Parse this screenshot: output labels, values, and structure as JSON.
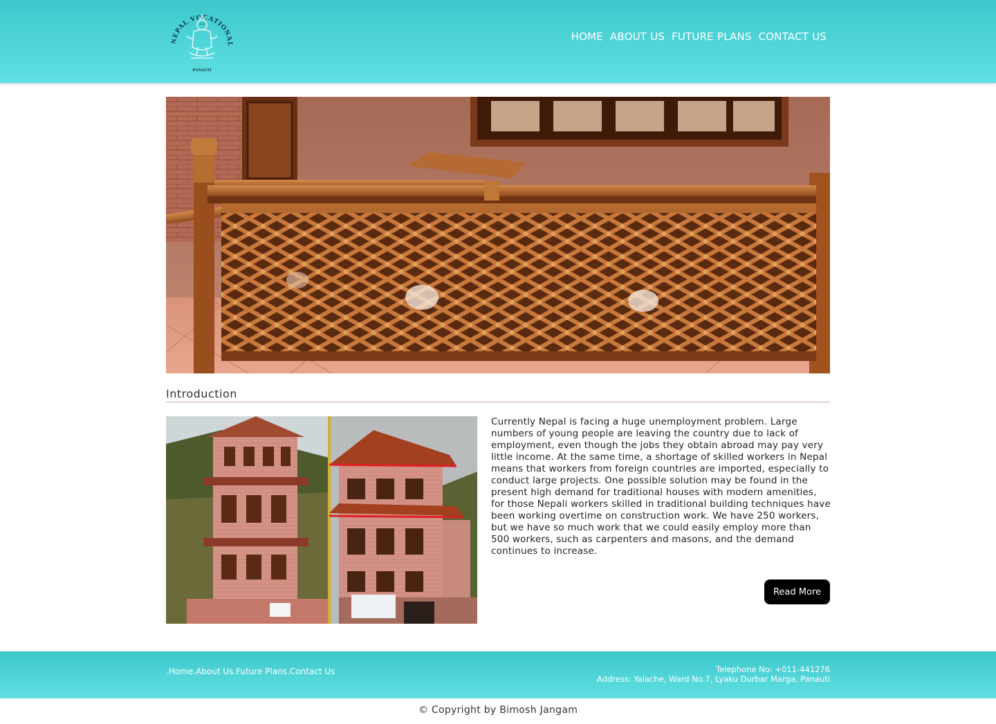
{
  "header": {
    "logo": {
      "text_top": "NEPAL VOCATIONAL ACADEMY",
      "text_bottom": "PANAUTI",
      "icon": "deity-emblem-logo"
    },
    "nav": [
      {
        "label": "HOME"
      },
      {
        "label": "ABOUT US"
      },
      {
        "label": "FUTURE PLANS"
      },
      {
        "label": "CONTACT US"
      }
    ]
  },
  "hero": {
    "alt": "carved wooden lattice railing"
  },
  "intro": {
    "title": "Introduction",
    "body": "Currently Nepal is facing a huge unemployment problem. Large numbers of young people are leaving the country due to lack of employment, even though the jobs they obtain abroad may pay very little income. At the same time, a shortage of skilled workers in Nepal means that workers from foreign countries are imported, especially to conduct large projects. One possible solution may be found in the present high demand for traditional houses with modern amenities, for those Nepali workers skilled in traditional building techniques have been working overtime on construction work. We have 250 workers, but we have so much work that we could easily employ more than 500 workers, such as carpenters and masons, and the demand continues to increase.",
    "read_more": "Read More"
  },
  "footer": {
    "links": [
      {
        "label": ".Home"
      },
      {
        "label": ".About Us"
      },
      {
        "label": ".Future Plans"
      },
      {
        "label": ".Contact Us"
      }
    ],
    "telephone": "Telephone No: +011-441276",
    "address": "Address: Yalache, Ward No.7, Lyaku Durbar Marga, Panauti"
  },
  "copyright": "© Copyright by Bimosh Jangam",
  "colors": {
    "header_top": "#3ec8cc",
    "header_bottom": "#5fe0e2",
    "button_bg": "#000000"
  }
}
